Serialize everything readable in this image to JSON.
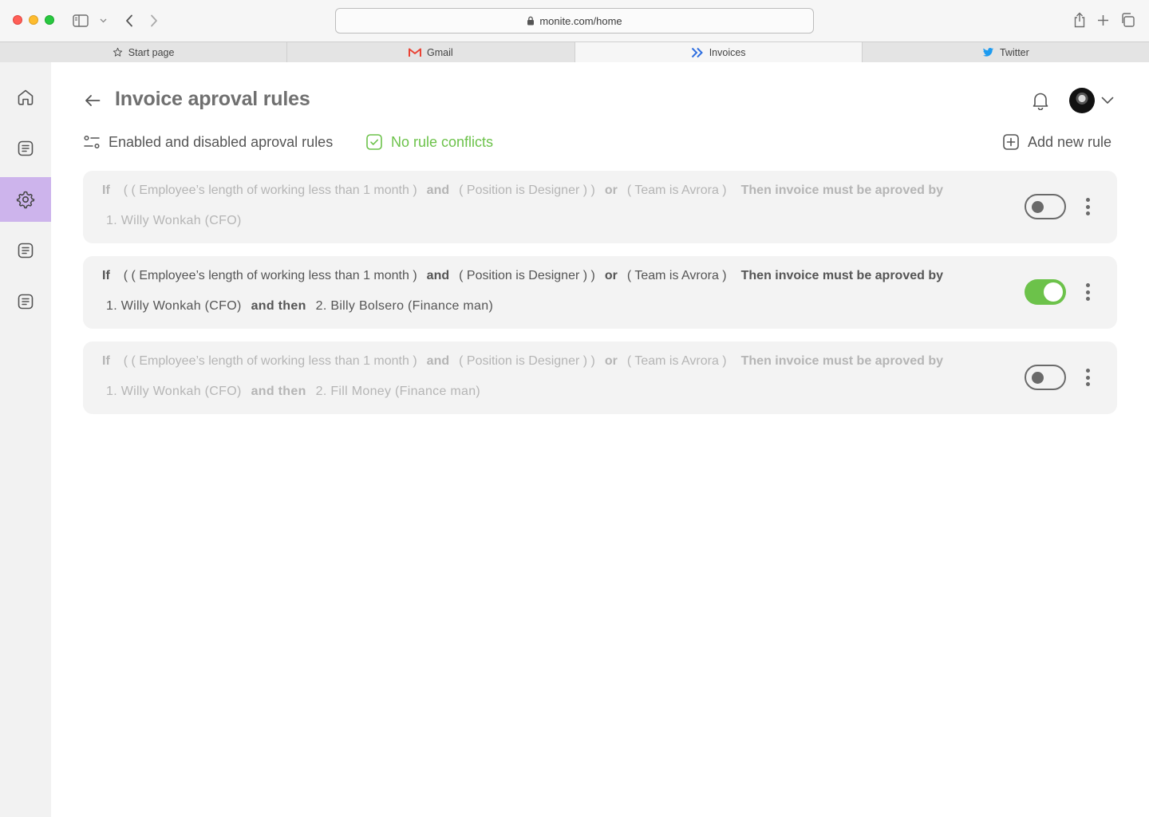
{
  "browser": {
    "url": "monite.com/home",
    "tabs": [
      {
        "label": "Start page",
        "icon": "star-icon"
      },
      {
        "label": "Gmail",
        "icon": "gmail-icon"
      },
      {
        "label": "Invoices",
        "icon": "monite-icon",
        "active": true
      },
      {
        "label": "Twitter",
        "icon": "twitter-icon"
      }
    ]
  },
  "sidebar": {
    "items": [
      {
        "icon": "home-icon"
      },
      {
        "icon": "document-icon"
      },
      {
        "icon": "gear-icon",
        "active": true
      },
      {
        "icon": "document-icon"
      },
      {
        "icon": "document-icon"
      }
    ],
    "accent": "#cdb4ec"
  },
  "header": {
    "title": "Invoice aproval rules"
  },
  "toolbar": {
    "filter_label": "Enabled and disabled aproval rules",
    "conflicts_label": "No rule conflicts",
    "add_rule_label": "Add new rule"
  },
  "colors": {
    "success": "#6cc24a",
    "toggle_off": "#6a6a6a"
  },
  "rules": [
    {
      "enabled": false,
      "if_kw": "If",
      "cond1": "( ( Employee’s length of working less than 1 month )",
      "and_kw": "and",
      "cond2": "( Position is Designer ) )",
      "or_kw": "or",
      "cond3": "( Team is Avrora )",
      "then_text": "Then invoice must be aproved by",
      "approver1": "1. Willy Wonkah (CFO)"
    },
    {
      "enabled": true,
      "if_kw": "If",
      "cond1": "( ( Employee’s length of working less than 1 month )",
      "and_kw": "and",
      "cond2": "( Position is Designer ) )",
      "or_kw": "or",
      "cond3": "( Team is Avrora )",
      "then_text": "Then invoice must be aproved by",
      "approver1": "1. Willy Wonkah (CFO)",
      "and_then_kw": "and then",
      "approver2": "2. Billy Bolsero (Finance man)"
    },
    {
      "enabled": false,
      "if_kw": "If",
      "cond1": "( ( Employee’s length of working less than 1 month )",
      "and_kw": "and",
      "cond2": "( Position is Designer ) )",
      "or_kw": "or",
      "cond3": "( Team is Avrora )",
      "then_text": "Then invoice must be aproved by",
      "approver1": "1. Willy Wonkah (CFO)",
      "and_then_kw": "and then",
      "approver2": "2. Fill Money (Finance man)"
    }
  ]
}
